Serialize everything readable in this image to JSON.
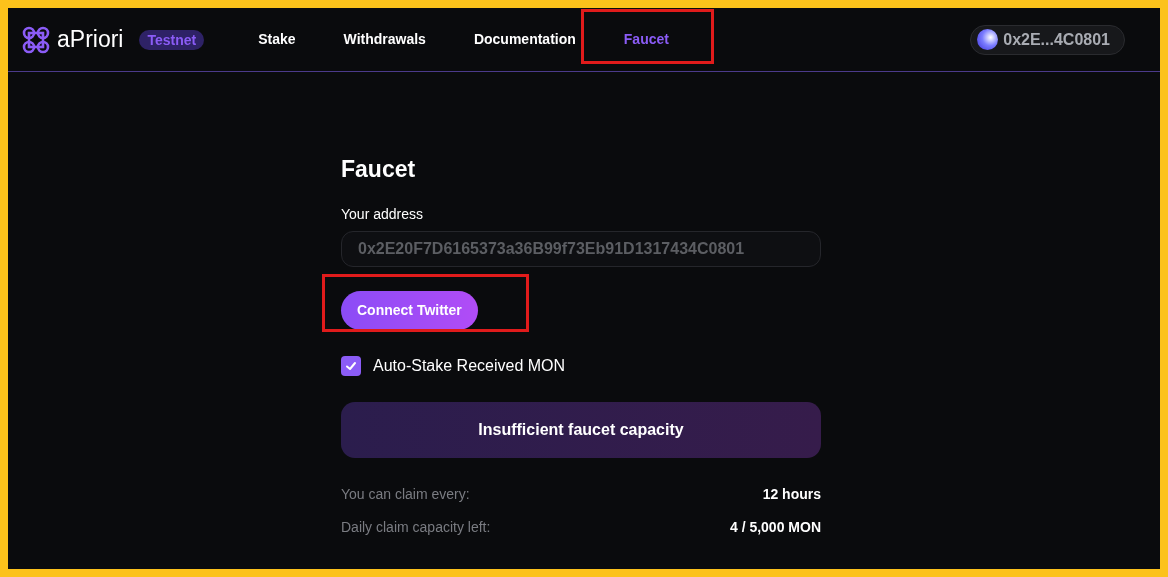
{
  "brand": {
    "name": "aPriori",
    "badge": "Testnet"
  },
  "nav": [
    {
      "label": "Stake",
      "selected": false,
      "highlighted": false
    },
    {
      "label": "Withdrawals",
      "selected": false,
      "highlighted": false
    },
    {
      "label": "Documentation",
      "selected": false,
      "highlighted": false
    },
    {
      "label": "Faucet",
      "selected": true,
      "highlighted": true
    }
  ],
  "wallet": {
    "address": "0x2E...4C0801"
  },
  "faucet": {
    "title": "Faucet",
    "address_label": "Your address",
    "address_value": "0x2E20F7D6165373a36B99f73Eb91D1317434C0801",
    "connect_button": {
      "label": "Connect Twitter",
      "highlighted": true
    },
    "auto_stake": {
      "label": "Auto-Stake Received MON",
      "checked": true
    },
    "claim_button": {
      "label": "Insufficient faucet capacity",
      "disabled": true
    },
    "info": [
      {
        "label": "You can claim every:",
        "value": "12 hours"
      },
      {
        "label": "Daily claim capacity left:",
        "value": "4 / 5,000 MON"
      }
    ]
  }
}
